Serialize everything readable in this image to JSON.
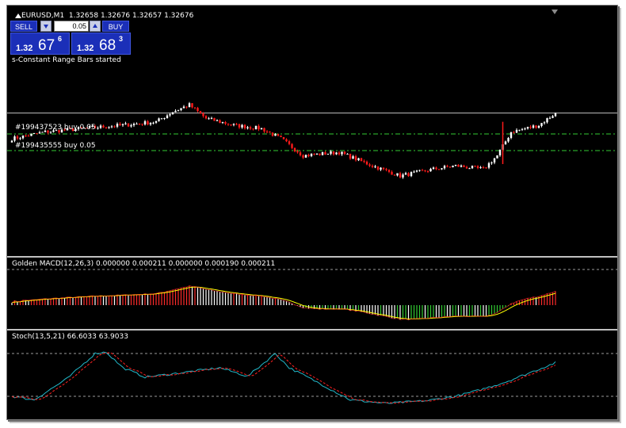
{
  "chart": {
    "header": {
      "symbol": "EURUSD,M1",
      "prices": "1.32658 1.32676 1.32657 1.32676"
    },
    "status_text": "s-Constant Range Bars started"
  },
  "trade_panel": {
    "sell_label": "SELL",
    "buy_label": "BUY",
    "lot": "0.05",
    "bid": {
      "small": "1.32",
      "big": "67",
      "sup": "6"
    },
    "ask": {
      "small": "1.32",
      "big": "68",
      "sup": "3"
    }
  },
  "orders": [
    {
      "label": "#199437523 buy 0.05"
    },
    {
      "label": "#199435555 buy 0.05"
    }
  ],
  "macd": {
    "label": "Golden MACD(12,26,3) 0.000000 0.000211 0.000000 0.000190 0.000211"
  },
  "stoch": {
    "label": "Stoch(13,5,21) 66.6033 63.9033"
  },
  "colors": {
    "bull": "#ffffff",
    "bear": "#ff1a1a",
    "order_line": "#33cc33",
    "hist_pos_up": "#ff2a2a",
    "hist_neg_up": "#33cc33",
    "hist_white": "#ffffff",
    "signal": "#ffff00",
    "stoch_main": "#21b8c9",
    "stoch_signal": "#ff2020"
  },
  "chart_data": [
    {
      "type": "candlestick",
      "symbol": "EURUSD",
      "timeframe": "M1",
      "anchors": [
        [
          0,
          1.326
        ],
        [
          12,
          1.3262
        ],
        [
          25,
          1.3263
        ],
        [
          40,
          1.3264
        ],
        [
          52,
          1.3265
        ],
        [
          58,
          1.3268
        ],
        [
          64,
          1.327
        ],
        [
          70,
          1.3266
        ],
        [
          80,
          1.3264
        ],
        [
          90,
          1.3263
        ],
        [
          97,
          1.326
        ],
        [
          105,
          1.3255
        ],
        [
          118,
          1.3256
        ],
        [
          130,
          1.3252
        ],
        [
          140,
          1.3249
        ],
        [
          152,
          1.3251
        ],
        [
          160,
          1.3252
        ],
        [
          170,
          1.3251
        ],
        [
          175,
          1.3255
        ],
        [
          180,
          1.3262
        ],
        [
          190,
          1.3264
        ],
        [
          196,
          1.32676
        ]
      ],
      "bars": 197
    },
    {
      "type": "histogram+line",
      "name": "Golden MACD(12,26,3)",
      "values_shown": [
        0.0,
        0.000211,
        0.0,
        0.00019,
        0.000211
      ]
    },
    {
      "type": "line",
      "name": "Stoch(13,5,21)",
      "main": 66.6033,
      "signal": 63.9033,
      "levels": [
        80,
        20
      ]
    }
  ]
}
